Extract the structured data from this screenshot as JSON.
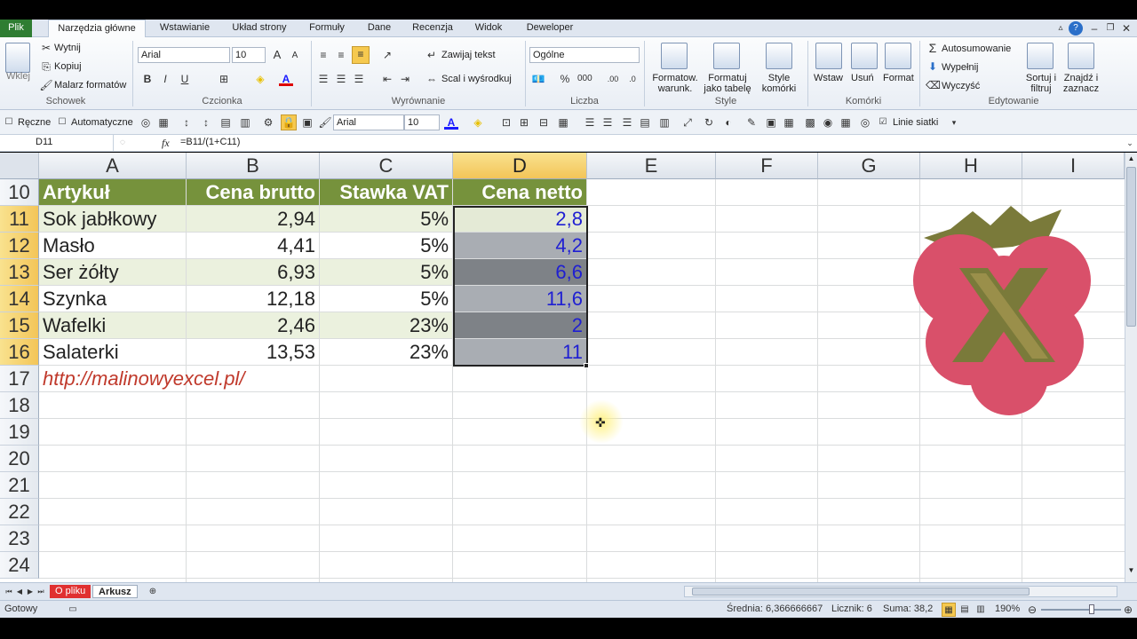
{
  "ribbon_tabs": [
    "Plik",
    "Narzędzia główne",
    "Wstawianie",
    "Układ strony",
    "Formuły",
    "Dane",
    "Recenzja",
    "Widok",
    "Deweloper"
  ],
  "clipboard": {
    "paste": "Wklej",
    "cut": "Wytnij",
    "copy": "Kopiuj",
    "format_painter": "Malarz formatów",
    "label": "Schowek"
  },
  "font": {
    "name": "Arial",
    "size": "10",
    "label": "Czcionka",
    "bold": "B",
    "italic": "I",
    "underline": "U"
  },
  "alignment": {
    "wrap": "Zawijaj tekst",
    "merge": "Scal i wyśrodkuj",
    "label": "Wyrównanie"
  },
  "number": {
    "format": "Ogólne",
    "label": "Liczba"
  },
  "styles": {
    "cond": "Formatow. warunk.",
    "table": "Formatuj jako tabelę",
    "cell": "Style komórki",
    "label": "Style"
  },
  "cells": {
    "insert": "Wstaw",
    "delete": "Usuń",
    "format": "Format",
    "label": "Komórki"
  },
  "editing": {
    "autosum": "Autosumowanie",
    "fill": "Wypełnij",
    "clear": "Wyczyść",
    "sort": "Sortuj i filtruj",
    "find": "Znajdź i zaznacz",
    "label": "Edytowanie"
  },
  "qat": {
    "manual": "Ręczne",
    "auto": "Automatyczne",
    "font": "Arial",
    "size": "10",
    "gridlines": "Linie siatki"
  },
  "name_box": "D11",
  "fx": "fx",
  "formula": "=B11/(1+C11)",
  "columns": [
    "A",
    "B",
    "C",
    "D",
    "E",
    "F",
    "G",
    "H",
    "I"
  ],
  "rows": [
    "10",
    "11",
    "12",
    "13",
    "14",
    "15",
    "16",
    "17",
    "18",
    "19",
    "20",
    "21",
    "22",
    "23",
    "24"
  ],
  "table": {
    "headers": [
      "Artykuł",
      "Cena brutto",
      "Stawka VAT",
      "Cena netto"
    ],
    "data": [
      [
        "Sok jabłkowy",
        "2,94",
        "5%",
        "2,8"
      ],
      [
        "Masło",
        "4,41",
        "5%",
        "4,2"
      ],
      [
        "Ser żółty",
        "6,93",
        "5%",
        "6,6"
      ],
      [
        "Szynka",
        "12,18",
        "5%",
        "11,6"
      ],
      [
        "Wafelki",
        "2,46",
        "23%",
        "2"
      ],
      [
        "Salaterki",
        "13,53",
        "23%",
        "11"
      ]
    ],
    "link": "http://malinowyexcel.pl/"
  },
  "sheets": {
    "tab1": "O pliku",
    "tab2": "Arkusz"
  },
  "status": {
    "ready": "Gotowy",
    "avg": "Średnia: 6,366666667",
    "count": "Licznik: 6",
    "sum": "Suma: 38,2",
    "zoom": "190%"
  },
  "colors": {
    "header_green": "#76923c",
    "band": "#ebf1de",
    "logo_red": "#d9506a",
    "logo_green": "#7a7a3a"
  }
}
